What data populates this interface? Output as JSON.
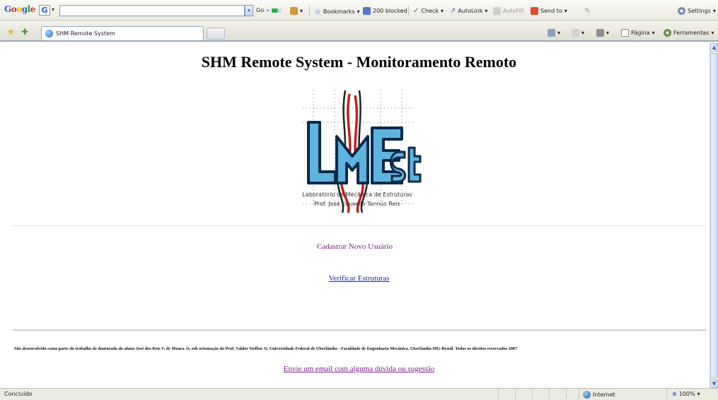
{
  "toolbar": {
    "google_parts": [
      "G",
      "o",
      "o",
      "g",
      "l",
      "e"
    ],
    "g_button": "G",
    "go_label": "Go",
    "bookmarks_label": "Bookmarks",
    "blocked_label": "200 blocked",
    "check_label": "Check",
    "autolink_label": "AutoLink",
    "autofill_label": "AutoFill",
    "sendto_label": "Send to",
    "settings_label": "Settings"
  },
  "tabs": {
    "active_title": "SHM Remote System",
    "page_menu": "Página",
    "tools_menu": "Ferramentas"
  },
  "page": {
    "title": "SHM Remote System - Monitoramento Remoto",
    "logo_caption_line1": "Laboratório de Mecânica de Estruturas",
    "logo_caption_line2": "Prof. José Eduardo Tannús Reis",
    "link_register": "Cadastrar Novo Usuário",
    "link_verify": "Verificar Estruturas",
    "footer_text": "Site desenvolvido como parte do trabalho de doutorado do aluno José dos Reis V. de Moura Jr, sob orientação do Prof. Valder Steffen Jr. Universidade Federal de Uberlândia - Faculdade de Engenharia Mecânica. Uberlândia-MG-Brasil. Todos os direitos reservados 2007",
    "email_link": "Envie um email com alguma dúvida ou sugestão"
  },
  "statusbar": {
    "status": "Concluído",
    "zone": "Internet",
    "zoom": "100%"
  }
}
